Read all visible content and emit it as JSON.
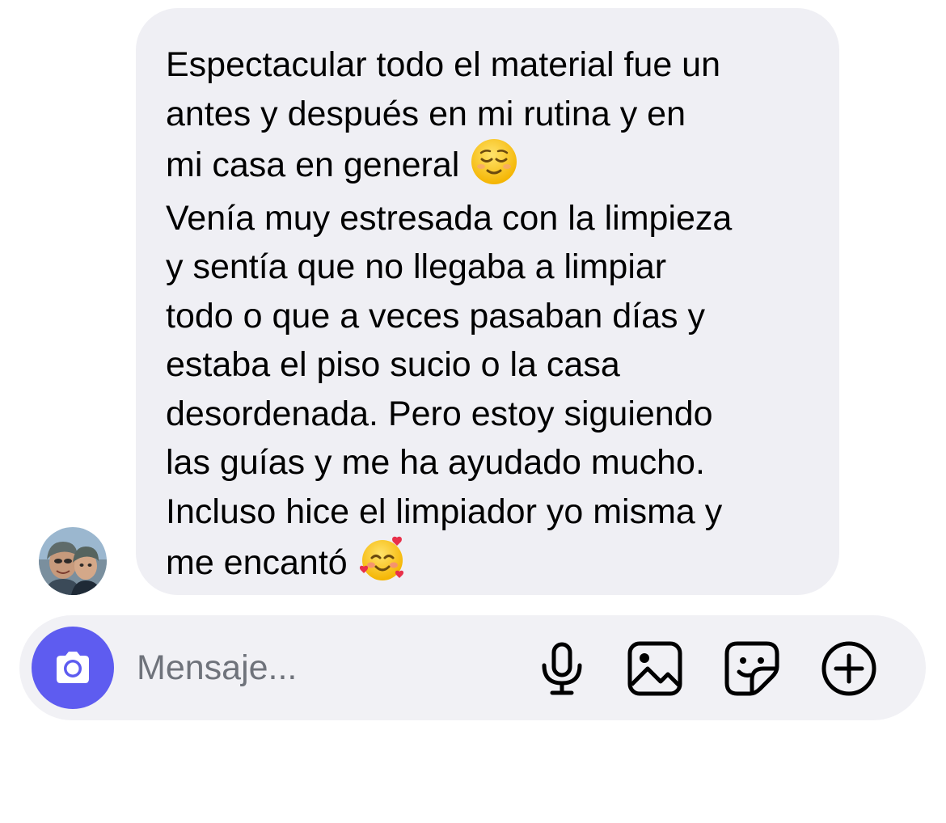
{
  "conversation": {
    "incoming_message": {
      "paragraph_1": "Espectacular todo el material fue un\nantes y después en mi rutina y en\nmi casa en general",
      "emoji_1": "relieved-face",
      "paragraph_2": "Venía muy estresada con la limpieza\ny sentía que no llegaba a limpiar\ntodo o que a veces pasaban días y\nestaba el piso sucio o la casa\ndesordenada. Pero estoy siguiendo\nlas guías y me ha ayudado mucho.\nIncluso hice el limpiador yo misma y\nme encantó",
      "emoji_2": "smiling-face-with-hearts",
      "bubble_color": "#efeff4"
    },
    "sender_avatar": "profile-photo"
  },
  "composer": {
    "placeholder": "Mensaje...",
    "value": "",
    "accent_color": "#5e5cf0",
    "icons": [
      "camera-icon",
      "microphone-icon",
      "gallery-icon",
      "sticker-icon",
      "plus-icon"
    ]
  }
}
